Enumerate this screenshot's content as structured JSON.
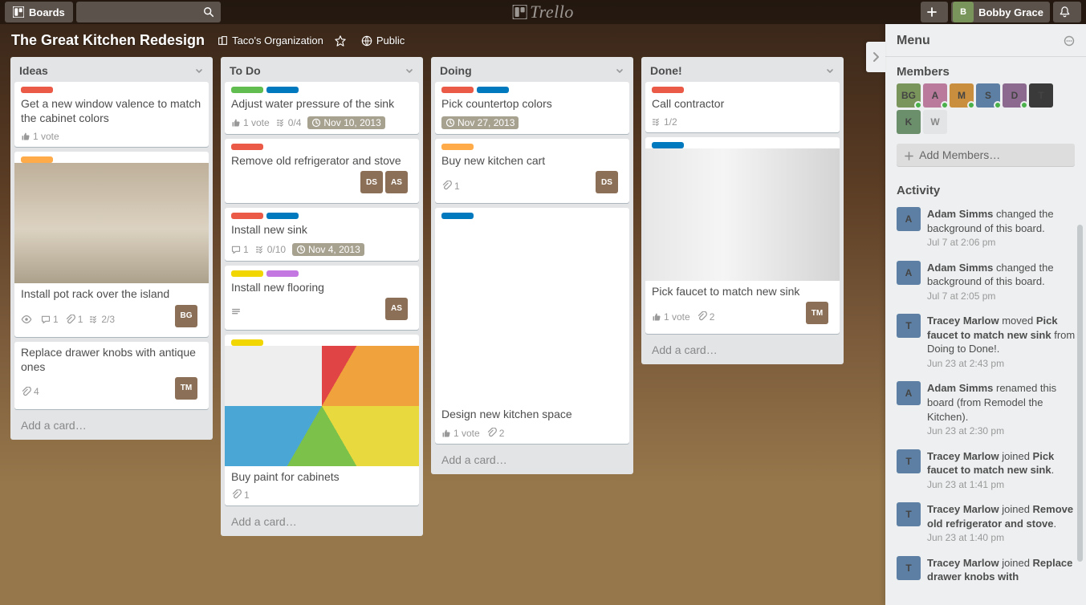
{
  "header": {
    "boards_label": "Boards",
    "user_name": "Bobby Grace",
    "logo_text": "Trello"
  },
  "board": {
    "title": "The Great Kitchen Redesign",
    "organization": "Taco's Organization",
    "visibility": "Public"
  },
  "lists": [
    {
      "name": "Ideas",
      "cards": [
        {
          "labels": [
            "red"
          ],
          "title": "Get a new window valence to match the cabinet colors",
          "votes": "1 vote"
        },
        {
          "labels": [
            "orange"
          ],
          "cover": "pots",
          "title": "Install pot rack over the island",
          "badges": {
            "watch": "",
            "comments": "1",
            "attachments": "1",
            "checklist": "2/3"
          },
          "members": [
            "BG"
          ]
        },
        {
          "title": "Replace drawer knobs with antique ones",
          "badges": {
            "attachments": "4"
          },
          "members": [
            "TM"
          ]
        }
      ],
      "add_card": "Add a card…"
    },
    {
      "name": "To Do",
      "cards": [
        {
          "labels": [
            "green",
            "blue"
          ],
          "title": "Adjust water pressure of the sink",
          "badges": {
            "votes": "1 vote",
            "checklist": "0/4",
            "due": {
              "text": "Nov 10, 2013",
              "past": true
            }
          }
        },
        {
          "labels": [
            "red"
          ],
          "title": "Remove old refrigerator and stove",
          "members": [
            "DS",
            "AS"
          ]
        },
        {
          "labels": [
            "red",
            "blue"
          ],
          "title": "Install new sink",
          "badges": {
            "comments": "1",
            "checklist": "0/10",
            "due": {
              "text": "Nov 4, 2013",
              "past": true
            }
          }
        },
        {
          "labels": [
            "yellow",
            "purple"
          ],
          "title": "Install new flooring",
          "badges": {
            "description": true
          },
          "members": [
            "AS"
          ]
        },
        {
          "labels": [
            "yellow"
          ],
          "cover": "paint",
          "title": "Buy paint for cabinets",
          "badges": {
            "attachments": "1"
          }
        }
      ],
      "add_card": "Add a card…"
    },
    {
      "name": "Doing",
      "cards": [
        {
          "labels": [
            "red",
            "blue"
          ],
          "title": "Pick countertop colors",
          "badges": {
            "due": {
              "text": "Nov 27, 2013",
              "past": true
            }
          }
        },
        {
          "labels": [
            "orange"
          ],
          "title": "Buy new kitchen cart",
          "badges": {
            "attachments": "1"
          },
          "members": [
            "DS"
          ]
        },
        {
          "labels": [
            "blue"
          ],
          "cover": "plan",
          "cover_height": 230,
          "title": "Design new kitchen space",
          "badges": {
            "votes": "1 vote",
            "attachments": "2"
          }
        }
      ],
      "add_card": "Add a card…"
    },
    {
      "name": "Done!",
      "cards": [
        {
          "labels": [
            "red"
          ],
          "title": "Call contractor",
          "badges": {
            "checklist": "1/2"
          }
        },
        {
          "labels": [
            "blue"
          ],
          "cover": "faucet",
          "cover_height": 165,
          "title": "Pick faucet to match new sink",
          "badges": {
            "votes": "1 vote",
            "attachments": "2"
          },
          "members": [
            "TM"
          ]
        }
      ],
      "add_card": "Add a card…"
    }
  ],
  "menu": {
    "title": "Menu",
    "members_title": "Members",
    "add_members": "Add Members…",
    "activity_title": "Activity",
    "members": [
      "BG",
      "A",
      "M",
      "S",
      "D",
      "T",
      "K",
      "W"
    ],
    "activity": [
      {
        "who": "Adam Simms",
        "text": " changed the background of this board.",
        "time": "Jul 7 at 2:06 pm"
      },
      {
        "who": "Adam Simms",
        "text": " changed the background of this board.",
        "time": "Jul 7 at 2:05 pm"
      },
      {
        "who": "Tracey Marlow",
        "text": " moved ",
        "bold1": "Pick faucet to match new sink",
        "text2": " from Doing to Done!.",
        "time": "Jun 23 at 2:43 pm"
      },
      {
        "who": "Adam Simms",
        "text": " renamed this board (from Remodel the Kitchen). ",
        "time": "Jun 23 at 2:30 pm"
      },
      {
        "who": "Tracey Marlow",
        "text": " joined ",
        "bold1": "Pick faucet to match new sink",
        "text2": ".",
        "time": "Jun 23 at 1:41 pm"
      },
      {
        "who": "Tracey Marlow",
        "text": " joined ",
        "bold1": "Remove old refrigerator and stove",
        "text2": ". ",
        "time": "Jun 23 at 1:40 pm"
      },
      {
        "who": "Tracey Marlow",
        "text": " joined ",
        "bold1": "Replace drawer knobs with",
        "text2": "",
        "time": ""
      }
    ]
  }
}
